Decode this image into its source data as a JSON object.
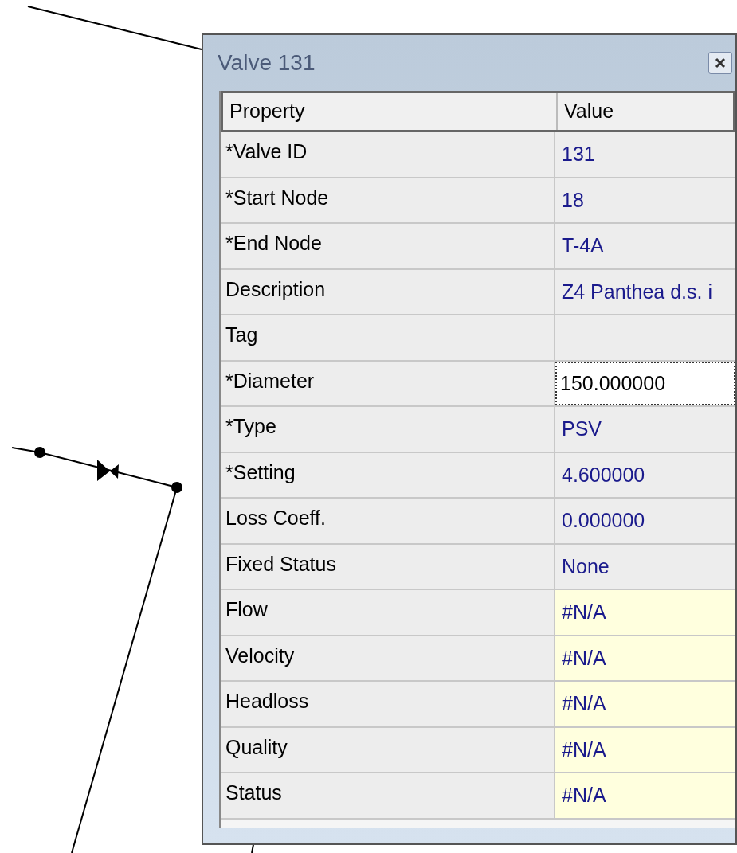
{
  "window": {
    "title": "Valve 131"
  },
  "table": {
    "columns": [
      "Property",
      "Value"
    ],
    "rows": [
      {
        "property": "*Valve ID",
        "value": "131",
        "kind": "value"
      },
      {
        "property": "*Start Node",
        "value": "18",
        "kind": "value"
      },
      {
        "property": "*End Node",
        "value": "T-4A",
        "kind": "value"
      },
      {
        "property": "Description",
        "value": "Z4 Panthea d.s. i",
        "kind": "value"
      },
      {
        "property": "Tag",
        "kind": "value"
      },
      {
        "property": "*Diameter",
        "value": "150.000000",
        "kind": "edit"
      },
      {
        "property": "*Type",
        "value": "PSV",
        "kind": "value"
      },
      {
        "property": "*Setting",
        "value": "4.600000",
        "kind": "value"
      },
      {
        "property": "Loss Coeff.",
        "value": "0.000000",
        "kind": "value"
      },
      {
        "property": "Fixed Status",
        "value": "None",
        "kind": "value"
      },
      {
        "property": "Flow",
        "value": "#N/A",
        "kind": "result"
      },
      {
        "property": "Velocity",
        "value": "#N/A",
        "kind": "result"
      },
      {
        "property": "Headloss",
        "value": "#N/A",
        "kind": "result"
      },
      {
        "property": "Quality",
        "value": "#N/A",
        "kind": "result"
      },
      {
        "property": "Status",
        "value": "#N/A",
        "kind": "result"
      }
    ]
  }
}
